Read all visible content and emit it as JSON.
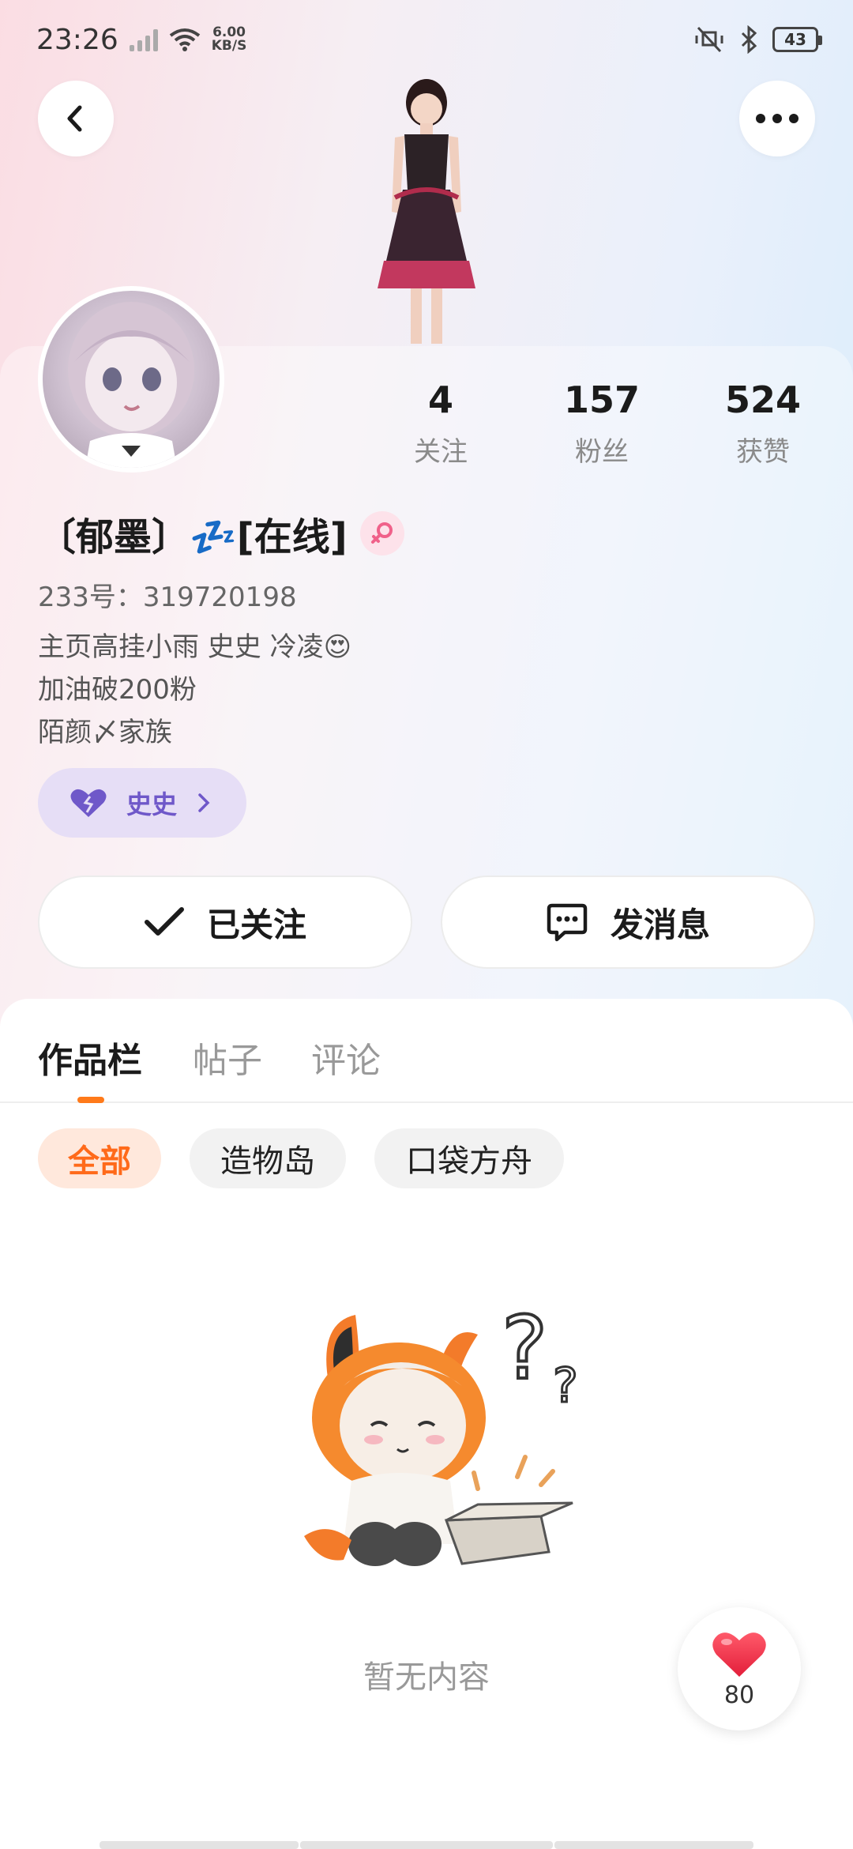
{
  "status_bar": {
    "time": "23:26",
    "net_speed_value": "6.00",
    "net_speed_unit": "KB/S",
    "battery": "43",
    "icons": [
      "signal-icon",
      "wifi-icon",
      "mute-icon",
      "bluetooth-icon",
      "battery-icon"
    ]
  },
  "header": {
    "back_icon": "chevron-left-icon",
    "more_icon": "more-dots-icon"
  },
  "profile": {
    "stats": [
      {
        "value": "4",
        "label": "关注"
      },
      {
        "value": "157",
        "label": "粉丝"
      },
      {
        "value": "524",
        "label": "获赞"
      }
    ],
    "username": "〔郁墨〕💤[在线]",
    "uid": "233号：319720198",
    "bio": [
      "主页高挂小雨  史史  冷凌😍",
      "加油破200粉",
      "陌颜〆家族"
    ],
    "tag": {
      "label": "史史",
      "icon": "heart-icon"
    },
    "accent_color": "#6f58c9"
  },
  "actions": {
    "follow_label": "已关注",
    "message_label": "发消息"
  },
  "tabs": [
    {
      "label": "作品栏",
      "active": true
    },
    {
      "label": "帖子",
      "active": false
    },
    {
      "label": "评论",
      "active": false
    }
  ],
  "filters": [
    {
      "label": "全部",
      "active": true
    },
    {
      "label": "造物岛",
      "active": false
    },
    {
      "label": "口袋方舟",
      "active": false
    }
  ],
  "empty_state": {
    "text": "暂无内容"
  },
  "like_fab": {
    "count": "80"
  },
  "colors": {
    "accent_orange": "#ff6a1a",
    "heart_red": "#f0324a"
  }
}
